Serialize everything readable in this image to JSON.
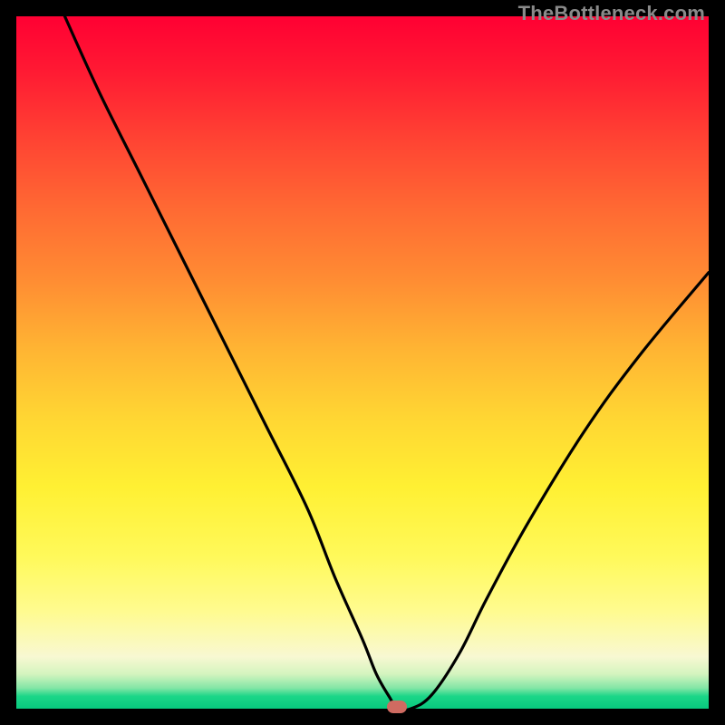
{
  "watermark": "TheBottleneck.com",
  "chart_data": {
    "type": "line",
    "title": "",
    "xlabel": "",
    "ylabel": "",
    "xlim": [
      0,
      100
    ],
    "ylim": [
      0,
      100
    ],
    "background_gradient": {
      "top_color": "#ff0033",
      "mid_color": "#fff033",
      "bottom_color": "#08c97e",
      "meaning": "bottleneck severity (red=high, green=0)"
    },
    "series": [
      {
        "name": "bottleneck-curve",
        "x": [
          7,
          12,
          18,
          24,
          30,
          36,
          42,
          46,
          50,
          52,
          54,
          55,
          57,
          60,
          64,
          68,
          74,
          82,
          90,
          100
        ],
        "y": [
          100,
          89,
          77,
          65,
          53,
          41,
          29,
          19,
          10,
          5,
          1.5,
          0,
          0,
          2,
          8,
          16,
          27,
          40,
          51,
          63
        ]
      }
    ],
    "marker": {
      "name": "optimal-point",
      "x": 55,
      "y": 0,
      "color": "#cf6b61"
    }
  }
}
